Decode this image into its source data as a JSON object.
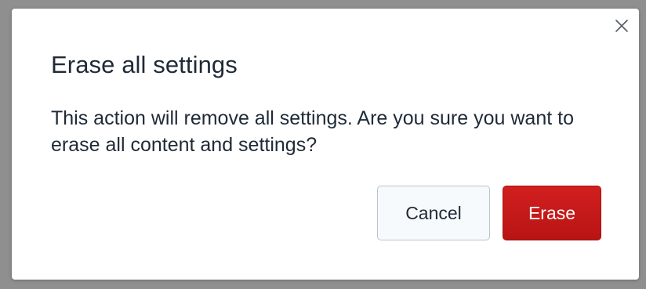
{
  "dialog": {
    "title": "Erase all settings",
    "message": "This action will remove all settings. Are you sure you want to erase all content and settings?",
    "close_icon": "close-icon",
    "buttons": {
      "cancel_label": "Cancel",
      "erase_label": "Erase"
    }
  },
  "colors": {
    "backdrop": "#8f8f8f",
    "danger": "#c81a1a",
    "text": "#1f2a37"
  }
}
